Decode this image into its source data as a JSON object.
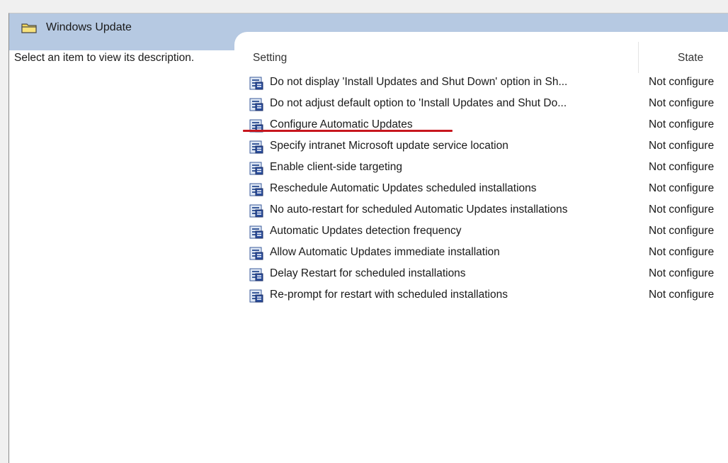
{
  "header": {
    "title": "Windows Update",
    "folder_icon": "folder-icon"
  },
  "description_pane": {
    "text": "Select an item to view its description."
  },
  "columns": {
    "setting": "Setting",
    "state": "State"
  },
  "policy_icon": "policy-setting-icon",
  "annotation": {
    "color": "#c7161e",
    "underlined_item": "Configure Automatic Updates"
  },
  "rows": [
    {
      "setting": "Do not display 'Install Updates and Shut Down' option in Sh...",
      "state": "Not configure"
    },
    {
      "setting": "Do not adjust default option to 'Install Updates and Shut Do...",
      "state": "Not configure"
    },
    {
      "setting": "Configure Automatic Updates",
      "state": "Not configure"
    },
    {
      "setting": "Specify intranet Microsoft update service location",
      "state": "Not configure"
    },
    {
      "setting": "Enable client-side targeting",
      "state": "Not configure"
    },
    {
      "setting": "Reschedule Automatic Updates scheduled installations",
      "state": "Not configure"
    },
    {
      "setting": "No auto-restart for scheduled Automatic Updates installations",
      "state": "Not configure"
    },
    {
      "setting": "Automatic Updates detection frequency",
      "state": "Not configure"
    },
    {
      "setting": "Allow Automatic Updates immediate installation",
      "state": "Not configure"
    },
    {
      "setting": "Delay Restart for scheduled installations",
      "state": "Not configure"
    },
    {
      "setting": "Re-prompt for restart with scheduled installations",
      "state": "Not configure"
    }
  ]
}
